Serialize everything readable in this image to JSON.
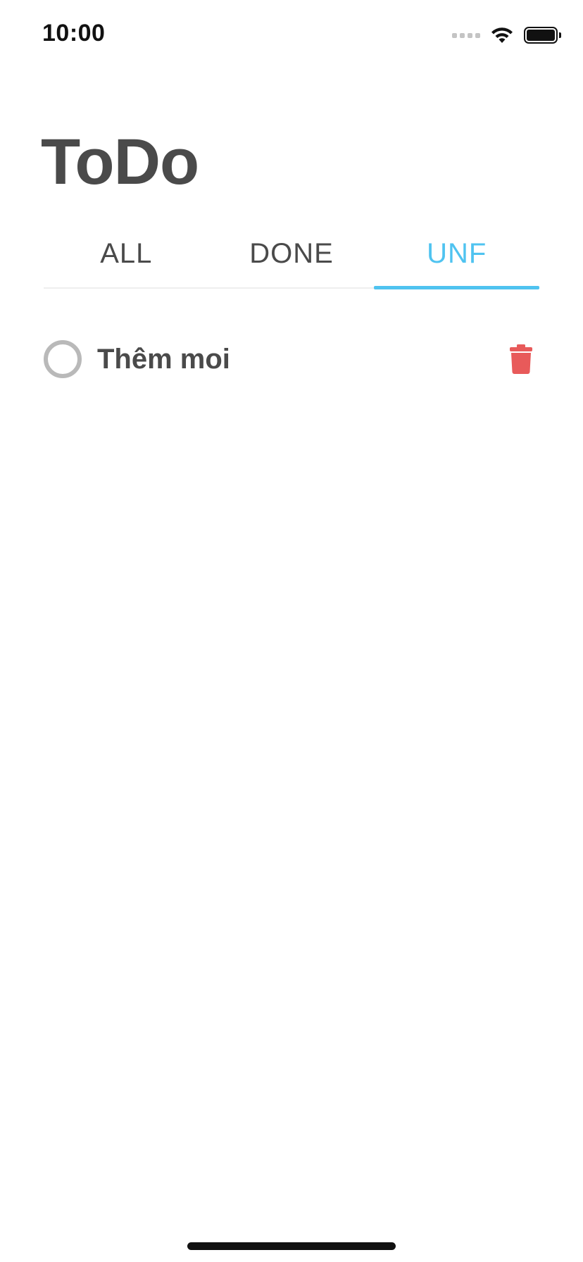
{
  "status_bar": {
    "time": "10:00",
    "icons": [
      "signal-dots-icon",
      "wifi-icon",
      "battery-icon"
    ]
  },
  "header": {
    "title": "ToDo"
  },
  "tabs": [
    {
      "label": "ALL",
      "active": false
    },
    {
      "label": "DONE",
      "active": false
    },
    {
      "label": "UNF",
      "active": true
    }
  ],
  "todos": [
    {
      "text": "Thêm moi",
      "done": false
    }
  ],
  "colors": {
    "accent": "#4fc3f0",
    "text": "#4a4a4a",
    "delete": "#e85a5a",
    "checkbox": "#b9b9b9"
  }
}
